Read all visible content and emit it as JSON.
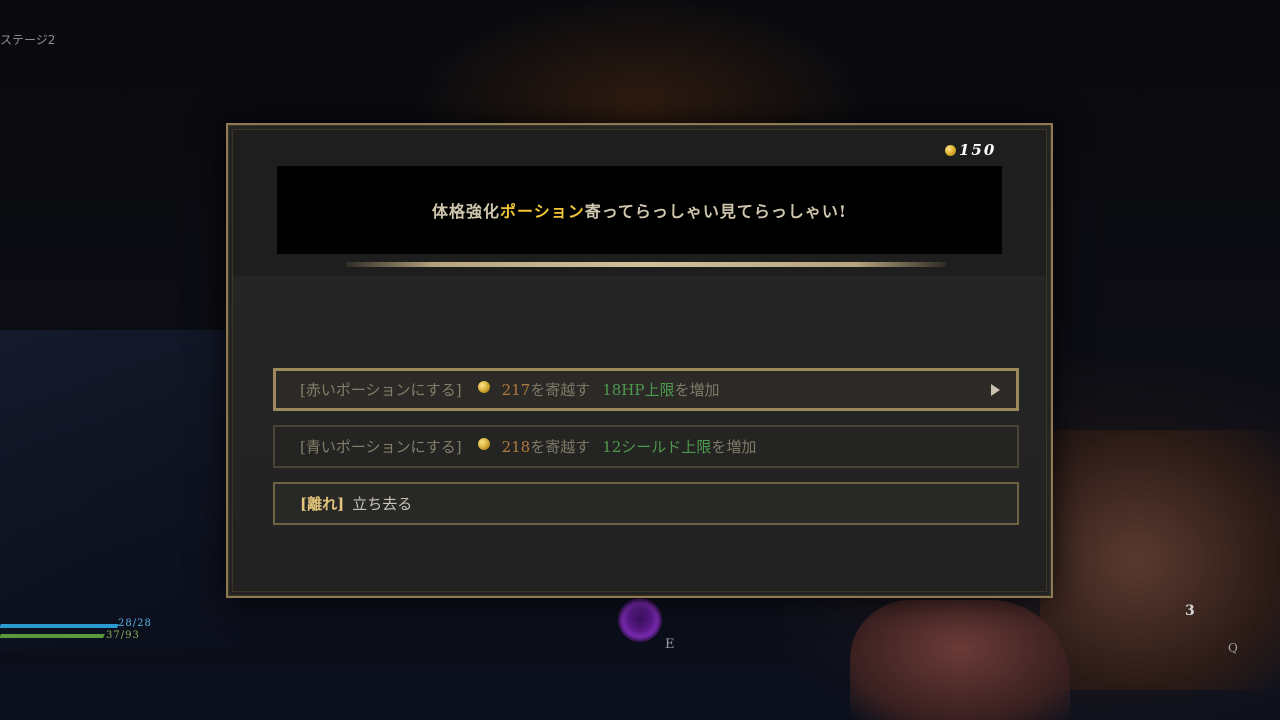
{
  "hud": {
    "stage_label": "ステージ2",
    "hp_text": "28/28",
    "shield_text": "37/93",
    "interact_key": "E",
    "skill_key": "Q",
    "skill_charges": "3"
  },
  "dialog": {
    "coins": "150",
    "banner": {
      "part1": "体格強化",
      "highlight": "ポーション",
      "part2": "寄ってらっしゃい見てらっしゃい!"
    },
    "options": [
      {
        "tag": "[赤いポーションにする]",
        "cost": "217",
        "cost_suffix": "を寄越す",
        "gain": "18HP上限",
        "gain_suffix": "を増加",
        "selected": true
      },
      {
        "tag": "[青いポーションにする]",
        "cost": "218",
        "cost_suffix": "を寄越す",
        "gain": "12シールド上限",
        "gain_suffix": "を増加",
        "selected": false
      },
      {
        "tag": "[離れ]",
        "label": "立ち去る"
      }
    ]
  },
  "colors": {
    "highlight": "#f2c53a",
    "cost": "#b07a3e",
    "gain": "#4e9a4e",
    "frame": "#8d7a55"
  }
}
